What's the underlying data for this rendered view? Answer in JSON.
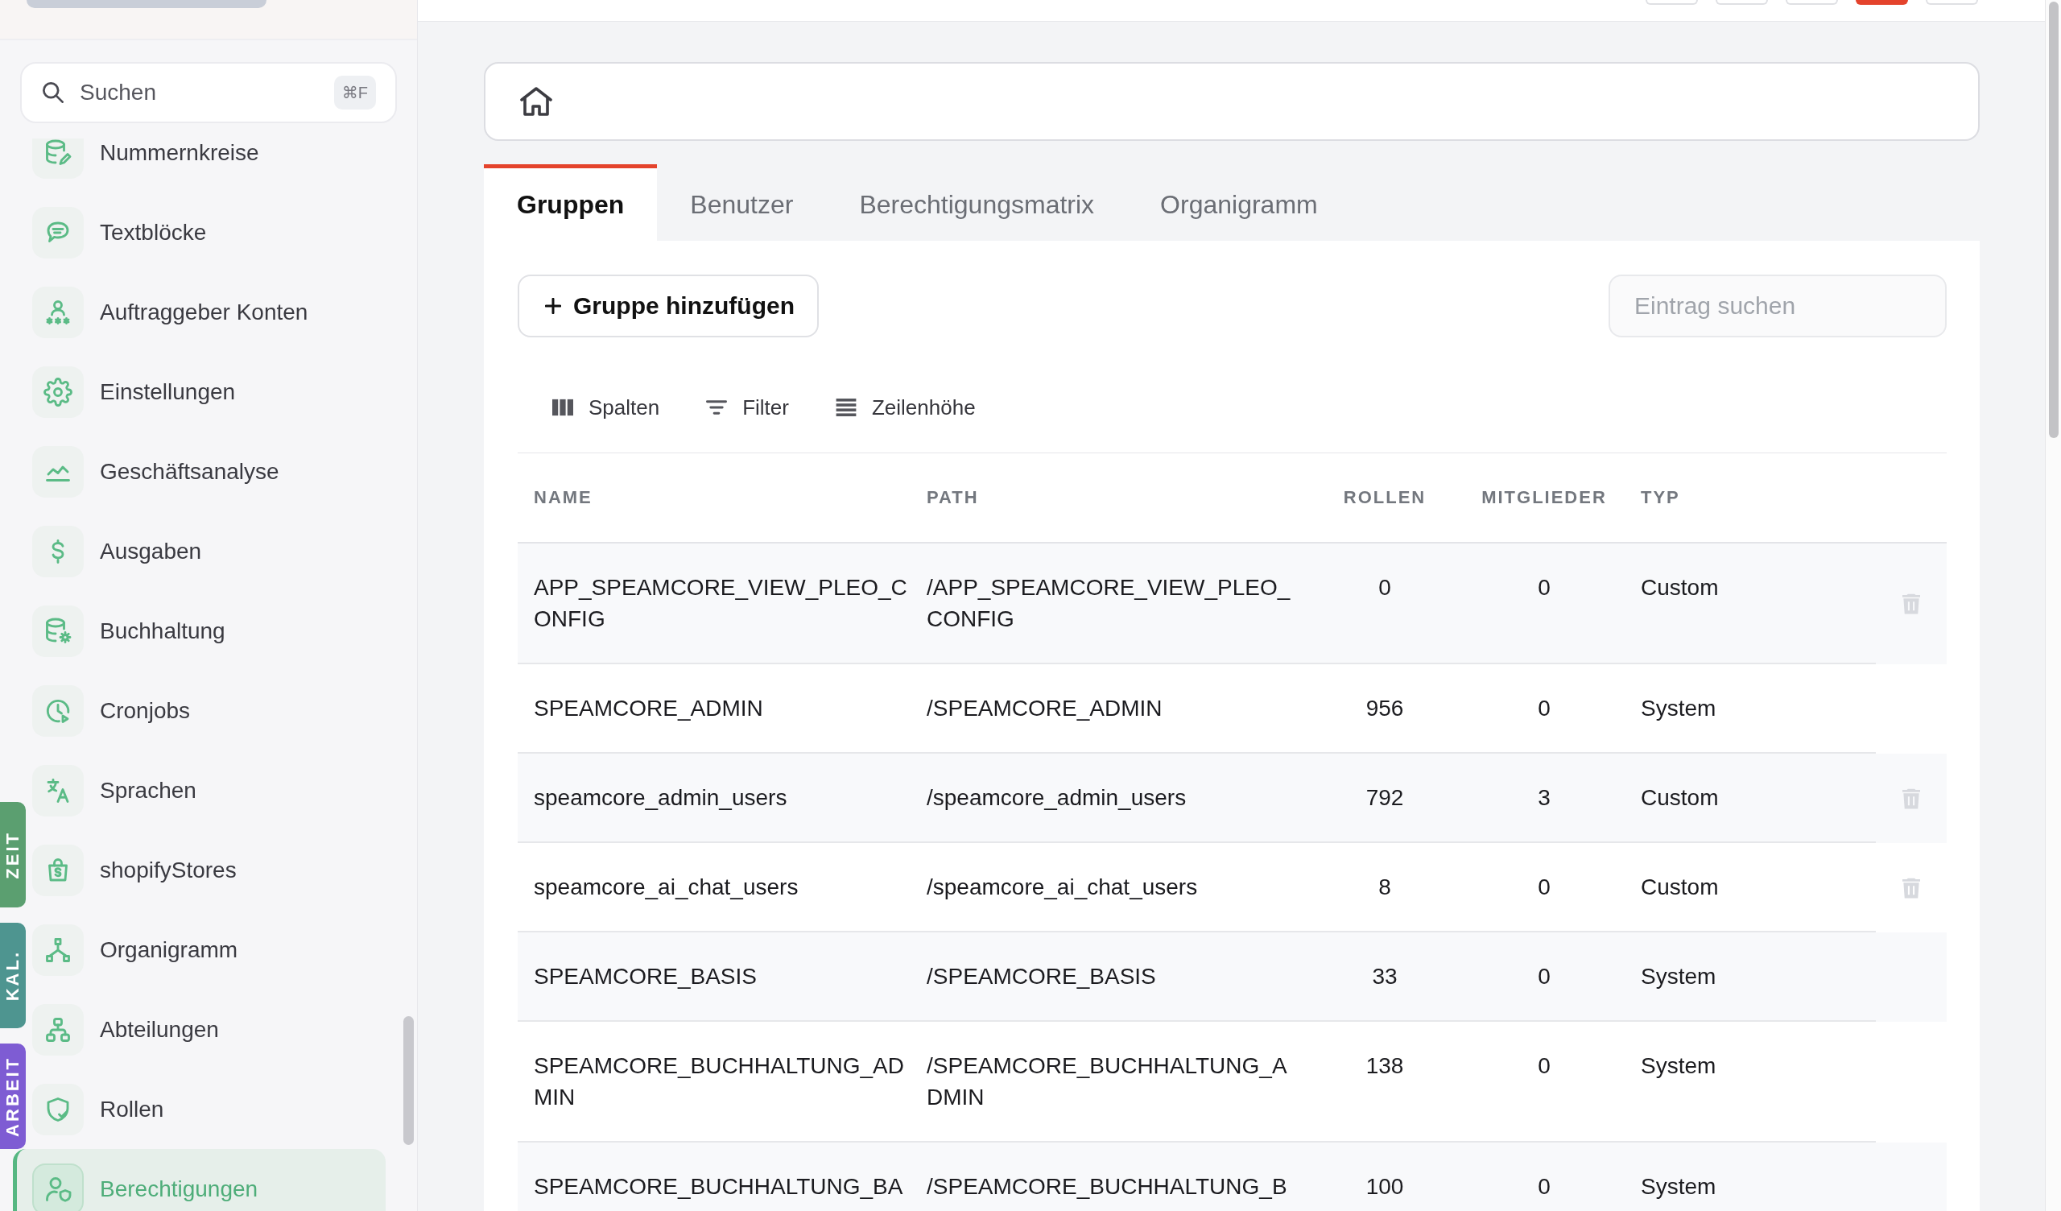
{
  "sidebar": {
    "search": {
      "placeholder": "Suchen",
      "shortcut": "⌘F"
    },
    "items": [
      {
        "label": "Nummernkreise",
        "selected": false
      },
      {
        "label": "Textblöcke",
        "selected": false
      },
      {
        "label": "Auftraggeber Konten",
        "selected": false
      },
      {
        "label": "Einstellungen",
        "selected": false
      },
      {
        "label": "Geschäftsanalyse",
        "selected": false
      },
      {
        "label": "Ausgaben",
        "selected": false
      },
      {
        "label": "Buchhaltung",
        "selected": false
      },
      {
        "label": "Cronjobs",
        "selected": false
      },
      {
        "label": "Sprachen",
        "selected": false
      },
      {
        "label": "shopifyStores",
        "selected": false
      },
      {
        "label": "Organigramm",
        "selected": false
      },
      {
        "label": "Abteilungen",
        "selected": false
      },
      {
        "label": "Rollen",
        "selected": false
      },
      {
        "label": "Berechtigungen",
        "selected": true
      }
    ]
  },
  "side_tabs": [
    {
      "label": "ZEIT",
      "color": "#5b9f70"
    },
    {
      "label": "KAL.",
      "color": "#4e9590"
    },
    {
      "label": "ARBEIT",
      "color": "#7e5cd3"
    }
  ],
  "header_buttons": [
    {
      "active": false
    },
    {
      "active": false
    },
    {
      "active": false
    },
    {
      "active": true
    },
    {
      "active": false
    }
  ],
  "tabs": [
    {
      "label": "Gruppen",
      "selected": true
    },
    {
      "label": "Benutzer",
      "selected": false
    },
    {
      "label": "Berechtigungsmatrix",
      "selected": false
    },
    {
      "label": "Organigramm",
      "selected": false
    }
  ],
  "actions": {
    "add_button": "Gruppe hinzufügen",
    "search": {
      "placeholder": "Eintrag suchen"
    }
  },
  "view_options": [
    "Spalten",
    "Filter",
    "Zeilenhöhe"
  ],
  "table": {
    "columns": [
      "NAME",
      "PATH",
      "ROLLEN",
      "MITGLIEDER",
      "TYP"
    ],
    "rows": [
      {
        "name": "APP_SPEAMCORE_VIEW_PLEO_CONFIG",
        "path": "/APP_SPEAMCORE_VIEW_PLEO_CONFIG",
        "roles": "0",
        "members": "0",
        "type": "Custom",
        "deletable": true
      },
      {
        "name": "SPEAMCORE_ADMIN",
        "path": "/SPEAMCORE_ADMIN",
        "roles": "956",
        "members": "0",
        "type": "System",
        "deletable": false
      },
      {
        "name": "speamcore_admin_users",
        "path": "/speamcore_admin_users",
        "roles": "792",
        "members": "3",
        "type": "Custom",
        "deletable": true
      },
      {
        "name": "speamcore_ai_chat_users",
        "path": "/speamcore_ai_chat_users",
        "roles": "8",
        "members": "0",
        "type": "Custom",
        "deletable": true
      },
      {
        "name": "SPEAMCORE_BASIS",
        "path": "/SPEAMCORE_BASIS",
        "roles": "33",
        "members": "0",
        "type": "System",
        "deletable": false
      },
      {
        "name": "SPEAMCORE_BUCHHALTUNG_ADMIN",
        "path": "/SPEAMCORE_BUCHHALTUNG_ADMIN",
        "roles": "138",
        "members": "0",
        "type": "System",
        "deletable": false
      },
      {
        "name": "SPEAMCORE_BUCHHALTUNG_BA",
        "path": "/SPEAMCORE_BUCHHALTUNG_B",
        "roles": "100",
        "members": "0",
        "type": "System",
        "deletable": false
      }
    ]
  }
}
